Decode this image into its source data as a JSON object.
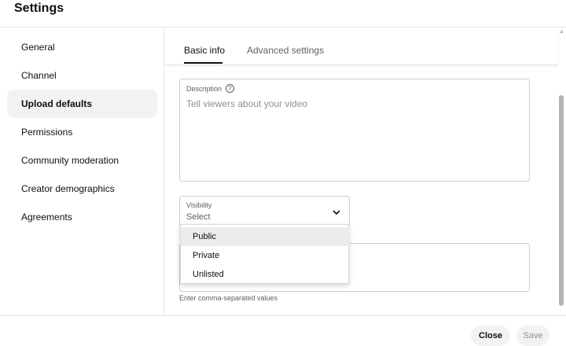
{
  "dialog": {
    "title": "Settings"
  },
  "sidebar": {
    "items": [
      {
        "label": "General",
        "active": false
      },
      {
        "label": "Channel",
        "active": false
      },
      {
        "label": "Upload defaults",
        "active": true
      },
      {
        "label": "Permissions",
        "active": false
      },
      {
        "label": "Community moderation",
        "active": false
      },
      {
        "label": "Creator demographics",
        "active": false
      },
      {
        "label": "Agreements",
        "active": false
      }
    ]
  },
  "tabs": {
    "basic": "Basic info",
    "advanced": "Advanced settings",
    "active": "Basic info"
  },
  "description": {
    "label": "Description",
    "help_icon": "?",
    "placeholder": "Tell viewers about your video"
  },
  "visibility": {
    "label": "Visibility",
    "value": "Select",
    "options": [
      "Public",
      "Private",
      "Unlisted"
    ],
    "highlighted": "Public"
  },
  "tags": {
    "hint": "Enter comma-separated values"
  },
  "footer": {
    "close_label": "Close",
    "save_label": "Save"
  },
  "colors": {
    "active_bg": "#f2f2f2",
    "border": "#cfcfcf",
    "muted_text": "#606060"
  }
}
